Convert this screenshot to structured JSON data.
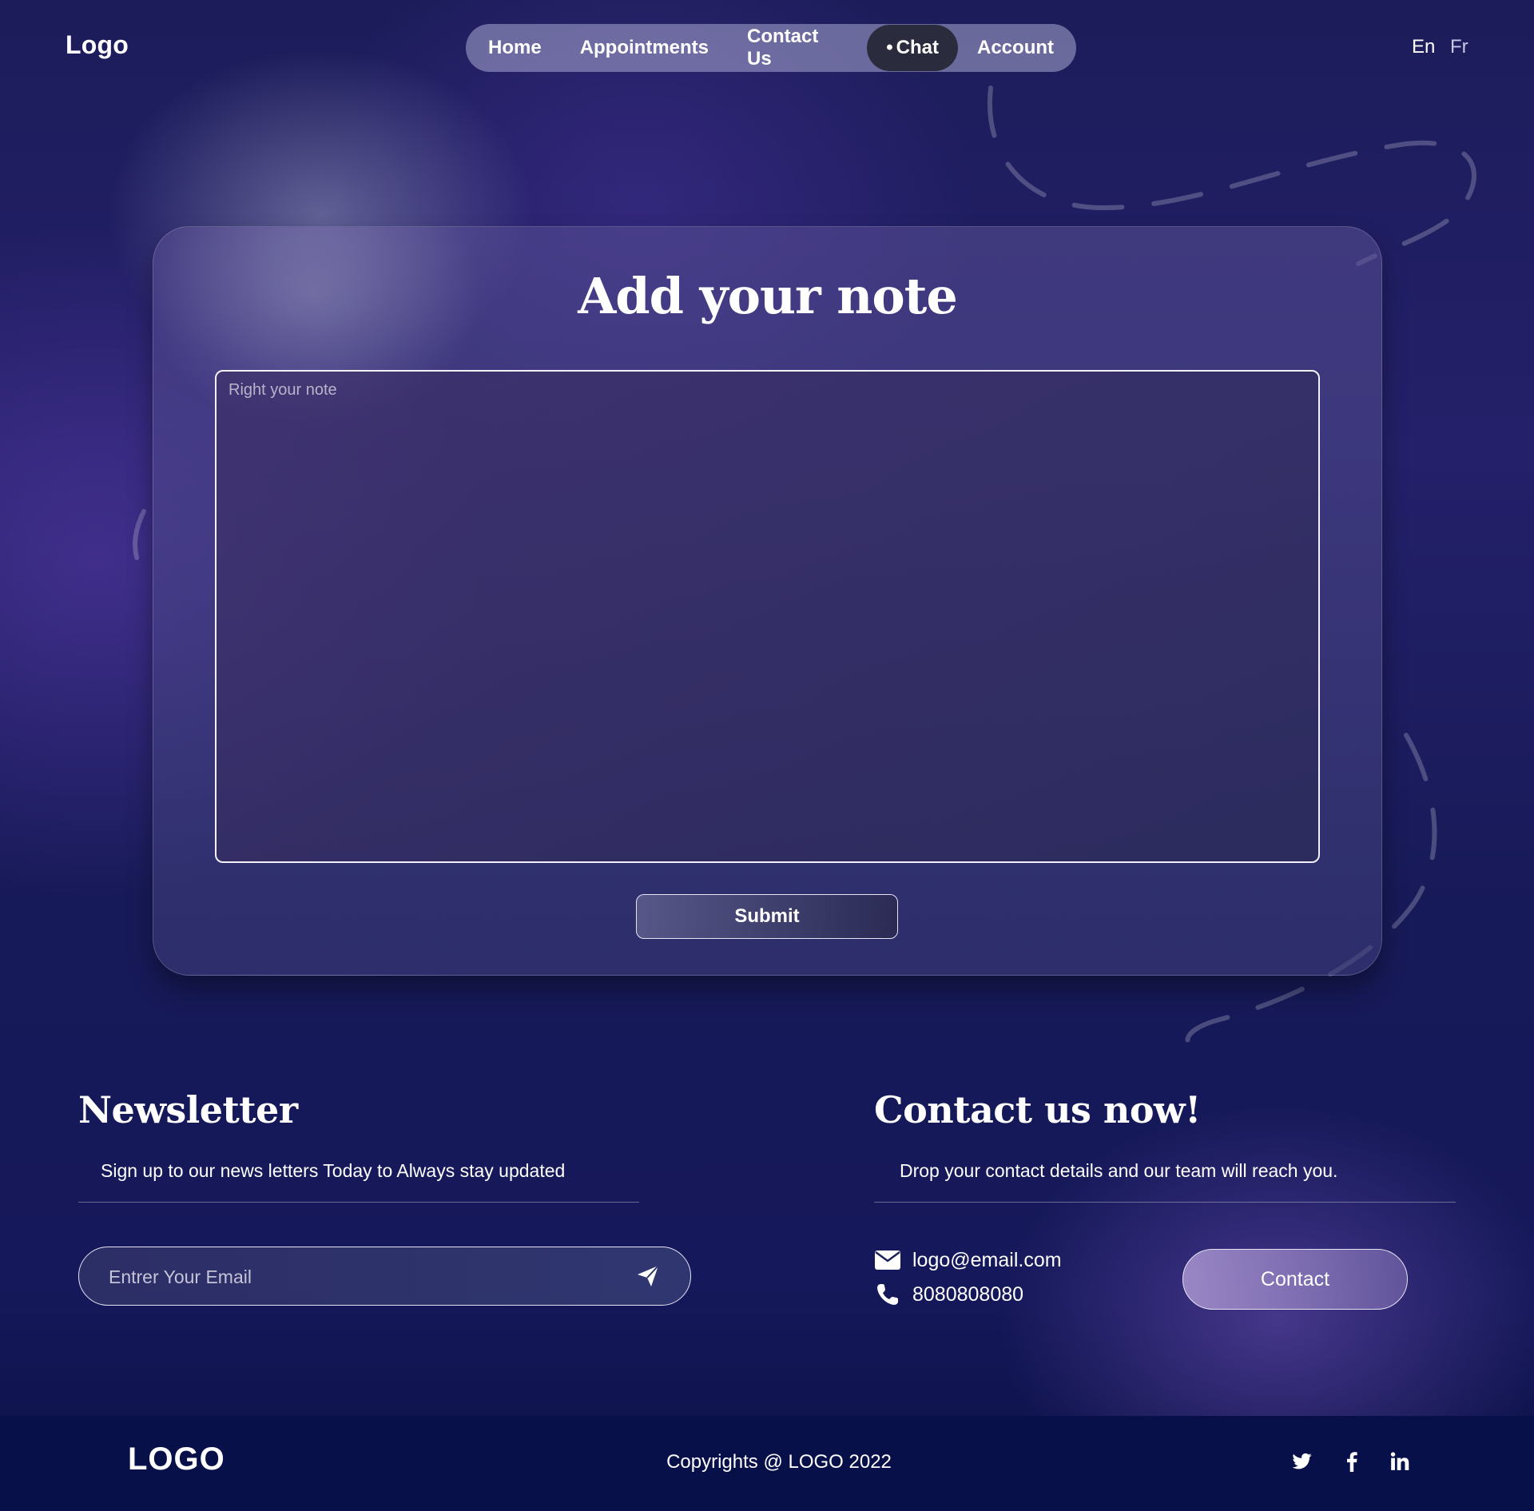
{
  "header": {
    "logo": "Logo",
    "nav": [
      "Home",
      "Appointments",
      "Contact Us",
      "Chat",
      "Account"
    ],
    "active_nav": "Chat",
    "languages": [
      "En",
      "Fr"
    ],
    "active_language": "En"
  },
  "note_card": {
    "title": "Add your note",
    "placeholder": "Right your note",
    "value": "",
    "submit_label": "Submit"
  },
  "newsletter": {
    "title": "Newsletter",
    "subtitle": "Sign up to our news letters Today to Always stay updated",
    "email_placeholder": "Entrer Your Email",
    "email_value": "",
    "send_icon": "send-icon"
  },
  "contact": {
    "title": "Contact us now!",
    "subtitle": "Drop your contact details and our team will reach you.",
    "email": "logo@email.com",
    "phone": "8080808080",
    "button_label": "Contact",
    "icons": [
      "mail-icon",
      "phone-icon"
    ]
  },
  "footer": {
    "logo": "LOGO",
    "copyright": "Copyrights @ LOGO 2022",
    "social_icons": [
      "twitter-icon",
      "facebook-icon",
      "linkedin-icon"
    ]
  },
  "colors": {
    "background_top": "#1c1c5a",
    "background_bottom": "#0b1146",
    "footer_bg": "#08104a",
    "nav_pill": "#a9a9d2",
    "nav_active": "#2a2b3d",
    "contact_button": "#a896d2"
  }
}
